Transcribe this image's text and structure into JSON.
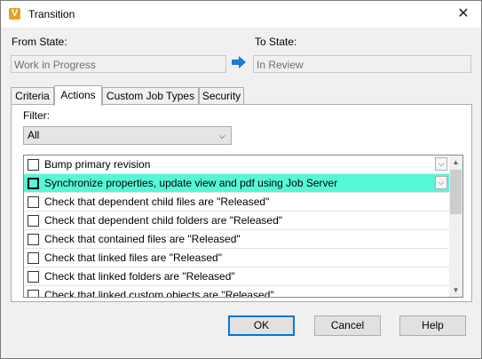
{
  "window": {
    "title": "Transition",
    "icon": "vault-app-icon",
    "close": "✕"
  },
  "from_state": {
    "label": "From State:",
    "value": "Work in Progress"
  },
  "to_state": {
    "label": "To State:",
    "value": "In Review"
  },
  "tabs": [
    {
      "label": "Criteria",
      "active": false
    },
    {
      "label": "Actions",
      "active": true
    },
    {
      "label": "Custom Job Types",
      "active": false
    },
    {
      "label": "Security",
      "active": false
    }
  ],
  "filter": {
    "label": "Filter:",
    "selected": "All"
  },
  "actions": [
    {
      "label": "Bump primary revision",
      "checked": false,
      "selected": false,
      "has_dropdown": true
    },
    {
      "label": "Synchronize properties, update view and pdf using Job Server",
      "checked": false,
      "selected": true,
      "has_dropdown": true
    },
    {
      "label": "Check that dependent child files are \"Released\"",
      "checked": false,
      "selected": false
    },
    {
      "label": "Check that dependent child folders are \"Released\"",
      "checked": false,
      "selected": false
    },
    {
      "label": "Check that contained files are \"Released\"",
      "checked": false,
      "selected": false
    },
    {
      "label": "Check that linked files are \"Released\"",
      "checked": false,
      "selected": false
    },
    {
      "label": "Check that linked folders are \"Released\"",
      "checked": false,
      "selected": false
    },
    {
      "label": "Check that linked custom objects are \"Released\"",
      "checked": false,
      "selected": false
    }
  ],
  "buttons": {
    "ok": "OK",
    "cancel": "Cancel",
    "help": "Help"
  },
  "colors": {
    "selection": "#56f7d7",
    "accent": "#0078d7",
    "arrow": "#1e78d2"
  }
}
